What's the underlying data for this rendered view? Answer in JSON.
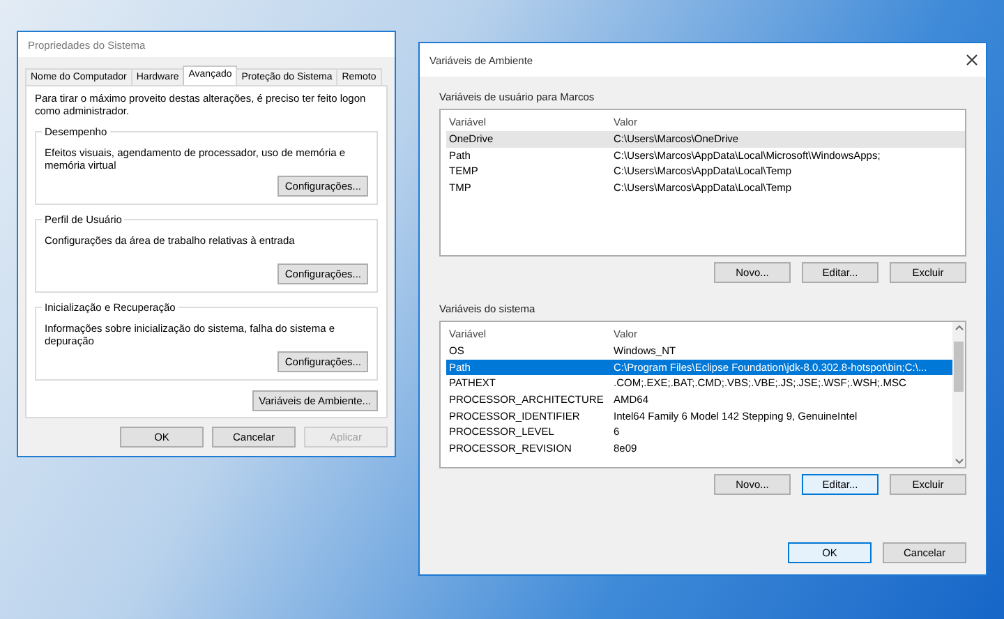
{
  "system_properties": {
    "title": "Propriedades do Sistema",
    "tabs": [
      {
        "label": "Nome do Computador",
        "selected": false
      },
      {
        "label": "Hardware",
        "selected": false
      },
      {
        "label": "Avançado",
        "selected": true
      },
      {
        "label": "Proteção do Sistema",
        "selected": false
      },
      {
        "label": "Remoto",
        "selected": false
      }
    ],
    "intro": "Para tirar o máximo proveito destas alterações, é preciso ter feito logon como administrador.",
    "groups": [
      {
        "title": "Desempenho",
        "description": "Efeitos visuais, agendamento de processador, uso de memória e memória virtual",
        "button": "Configurações..."
      },
      {
        "title": "Perfil de Usuário",
        "description": "Configurações da área de trabalho relativas à entrada",
        "button": "Configurações..."
      },
      {
        "title": "Inicialização e Recuperação",
        "description": "Informações sobre inicialização do sistema, falha do sistema e depuração",
        "button": "Configurações..."
      }
    ],
    "env_button": "Variáveis de Ambiente...",
    "buttons": [
      {
        "label": "OK",
        "disabled": false
      },
      {
        "label": "Cancelar",
        "disabled": false
      },
      {
        "label": "Aplicar",
        "disabled": true
      }
    ]
  },
  "environment_variables": {
    "title": "Variáveis de Ambiente",
    "sections": [
      {
        "title": "Variáveis de usuário para Marcos",
        "focused": false,
        "scrollbar": false,
        "columns": [
          "Variável",
          "Valor"
        ],
        "rows": [
          {
            "name": "OneDrive",
            "value": "C:\\Users\\Marcos\\OneDrive",
            "selected": true
          },
          {
            "name": "Path",
            "value": "C:\\Users\\Marcos\\AppData\\Local\\Microsoft\\WindowsApps;",
            "selected": false
          },
          {
            "name": "TEMP",
            "value": "C:\\Users\\Marcos\\AppData\\Local\\Temp",
            "selected": false
          },
          {
            "name": "TMP",
            "value": "C:\\Users\\Marcos\\AppData\\Local\\Temp",
            "selected": false
          }
        ],
        "buttons": [
          {
            "label": "Novo...",
            "focused": false
          },
          {
            "label": "Editar...",
            "focused": false
          },
          {
            "label": "Excluir",
            "focused": false
          }
        ]
      },
      {
        "title": "Variáveis do sistema",
        "focused": true,
        "scrollbar": true,
        "columns": [
          "Variável",
          "Valor"
        ],
        "rows": [
          {
            "name": "OS",
            "value": "Windows_NT",
            "selected": false
          },
          {
            "name": "Path",
            "value": "C:\\Program Files\\Eclipse Foundation\\jdk-8.0.302.8-hotspot\\bin;C:\\...",
            "selected": true
          },
          {
            "name": "PATHEXT",
            "value": ".COM;.EXE;.BAT;.CMD;.VBS;.VBE;.JS;.JSE;.WSF;.WSH;.MSC",
            "selected": false
          },
          {
            "name": "PROCESSOR_ARCHITECTURE",
            "value": "AMD64",
            "selected": false
          },
          {
            "name": "PROCESSOR_IDENTIFIER",
            "value": "Intel64 Family 6 Model 142 Stepping 9, GenuineIntel",
            "selected": false
          },
          {
            "name": "PROCESSOR_LEVEL",
            "value": "6",
            "selected": false
          },
          {
            "name": "PROCESSOR_REVISION",
            "value": "8e09",
            "selected": false
          }
        ],
        "buttons": [
          {
            "label": "Novo...",
            "focused": false
          },
          {
            "label": "Editar...",
            "focused": true
          },
          {
            "label": "Excluir",
            "focused": false
          }
        ]
      }
    ],
    "buttons": [
      {
        "label": "OK",
        "focused": true
      },
      {
        "label": "Cancelar",
        "focused": false
      }
    ]
  }
}
